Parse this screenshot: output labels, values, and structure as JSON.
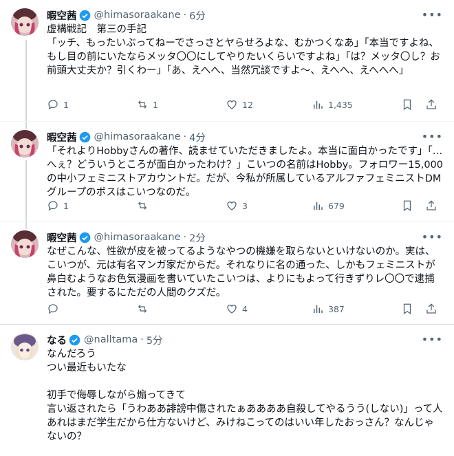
{
  "tweets": [
    {
      "name": "暇空茜",
      "handle": "@himasoraakane",
      "dot": "·",
      "time": "6分",
      "text": "虚構戦記　第三の手記\n「ッチ、もったいぶってねーでさっさとヤらせろよな、むかつくなあ」「本当ですよね、もし目の前にいたならメッタ〇〇にしてやりたいくらいですよね」「は？メッタ〇し？お前頭大丈夫か？引くわー」「あ、えへへ、当然冗談ですよ～、えへへ、えへへへ」",
      "replies": "1",
      "reposts": "1",
      "likes": "12",
      "views": "1,435"
    },
    {
      "name": "暇空茜",
      "handle": "@himasoraakane",
      "dot": "·",
      "time": "4分",
      "text": "「それよりHobbyさんの著作、読ませていただきましたよ。本当に面白かったです」「…へぇ？どういうところが面白かったわけ？」こいつの名前はHobby。フォロワー15,000の中小フェミニストアカウントだ。だが、今私が所属しているアルファフェミニストDMグループのボスはこいつなのだ。",
      "replies": "1",
      "reposts": "",
      "likes": "3",
      "views": "679"
    },
    {
      "name": "暇空茜",
      "handle": "@himasoraakane",
      "dot": "·",
      "time": "2分",
      "text": "なぜこんな、性欲が皮を被ってるようなやつの機嫌を取らないといけないのか。実は、こいつが、元は有名マンガ家だからだ。それなりに名の通った、しかもフェミニストが鼻白むようなお色気漫画を書いていたこいつは、よりにもよって行きずりレ〇〇で逮捕された。要するにただの人間のクズだ。",
      "replies": "",
      "reposts": "",
      "likes": "4",
      "views": "387"
    },
    {
      "name": "なる",
      "handle": "@nalltama",
      "dot": "·",
      "time": "5分",
      "text": "なんだろう\nつい最近もいたな\n\n初手で侮辱しながら煽ってきて\n言い返されたら「うわああ誹謗中傷されたぁああああ自殺してやるうう(しない)」って人\nあれはまだ学生だから仕方ないけど、みけねこってのはいい年したおっさん？なんじゃないの？",
      "replies": "",
      "reposts": "",
      "likes": "",
      "views": ""
    }
  ],
  "colors": {
    "verified": "#1d9bf0",
    "muted": "#536471"
  }
}
